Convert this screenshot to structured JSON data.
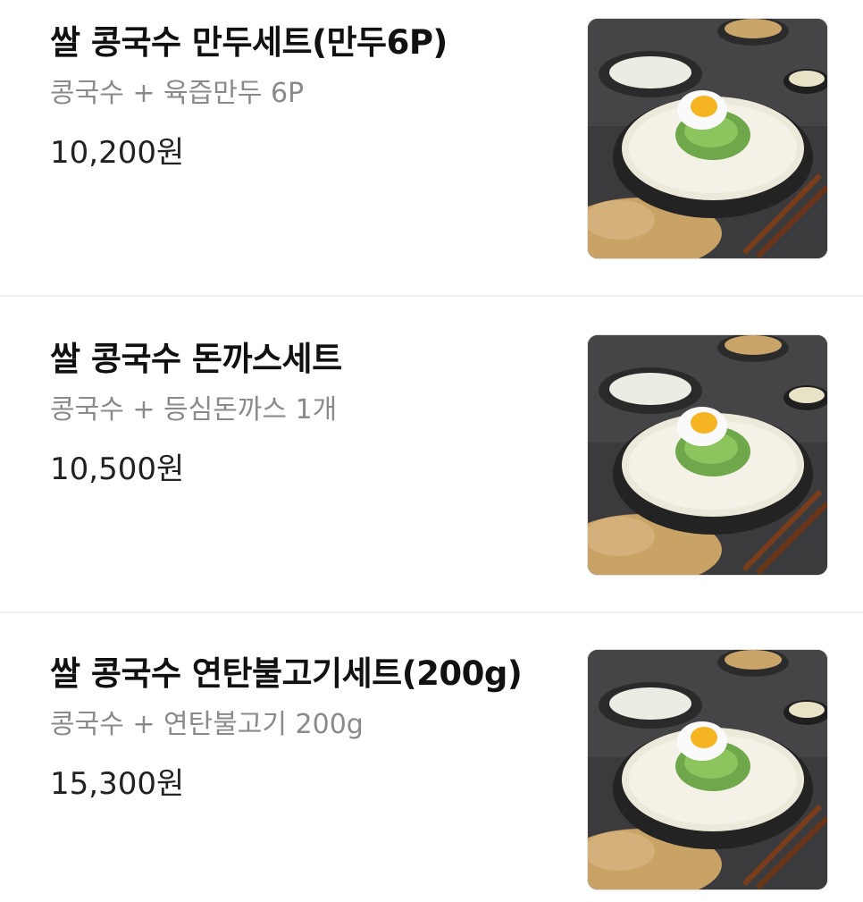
{
  "menu": {
    "items": [
      {
        "name": "쌀 콩국수 만두세트(만두6P)",
        "description": "콩국수 + 육즙만두 6P",
        "price": "10,200원"
      },
      {
        "name": "쌀 콩국수 돈까스세트",
        "description": "콩국수 + 등심돈까스 1개",
        "price": "10,500원"
      },
      {
        "name": "쌀 콩국수 연탄불고기세트(200g)",
        "description": "콩국수 + 연탄불고기 200g",
        "price": "15,300원"
      }
    ]
  },
  "colors": {
    "title": "#111111",
    "description": "#8a8a8a",
    "price": "#222222",
    "divider": "#eeeeee"
  }
}
